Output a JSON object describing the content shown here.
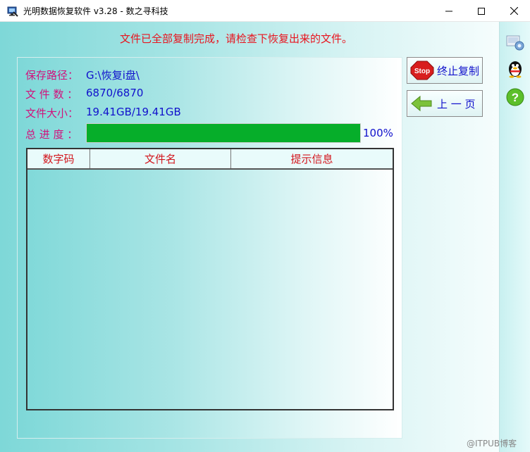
{
  "window": {
    "title": "光明数据恢复软件 v3.28 - 数之寻科技"
  },
  "status_message": "文件已全部复制完成，请检查下恢复出来的文件。",
  "info": {
    "save_path_label": "保存路径：",
    "save_path_value": "G:\\恢复i盘\\",
    "file_count_label": "文 件 数 ：",
    "file_count_value": "6870/6870",
    "file_size_label": "文件大小：",
    "file_size_value": "19.41GB/19.41GB",
    "progress_label": "总 进 度 ：",
    "progress_percent": 100,
    "progress_text": "100%"
  },
  "table": {
    "columns": [
      "数字码",
      "文件名",
      "提示信息"
    ],
    "rows": []
  },
  "buttons": {
    "stop_label": "终止复制",
    "stop_icon_text": "Stop",
    "back_label": "上 一 页"
  },
  "sidebar": {
    "icons": [
      "settings-icon",
      "qq-penguin-icon",
      "help-icon"
    ]
  },
  "watermark": "@ITPUB博客",
  "colors": {
    "label": "#d2117c",
    "value": "#1111cc",
    "status": "#e8141e",
    "progress": "#06ae2a",
    "header_text": "#d2151c"
  }
}
